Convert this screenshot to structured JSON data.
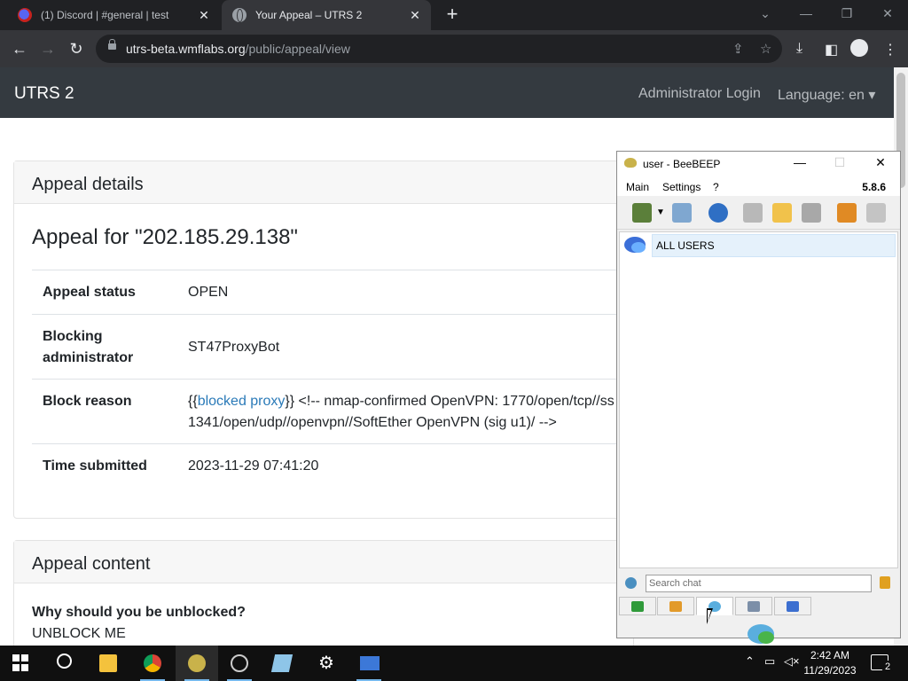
{
  "browser": {
    "tabs": [
      {
        "title": "(1) Discord | #general | test",
        "close": "✕"
      },
      {
        "title": "Your Appeal – UTRS 2",
        "close": "✕"
      }
    ],
    "new_tab": "+",
    "url_host": "utrs-beta.wmflabs.org",
    "url_path": "/public/appeal/view"
  },
  "page": {
    "brand": "UTRS 2",
    "nav": {
      "admin_login": "Administrator Login",
      "language": "Language: en ▾"
    },
    "details_card": {
      "header": "Appeal details",
      "title": "Appeal for \"202.185.29.138\"",
      "rows": {
        "status_label": "Appeal status",
        "status_value": "OPEN",
        "admin_label": "Blocking administrator",
        "admin_value": "ST47ProxyBot",
        "reason_label": "Block reason",
        "reason_prefix": "{{",
        "reason_link": "blocked proxy",
        "reason_line1_rest": "}} <!-- nmap-confirmed OpenVPN: 1770/open/tcp//ss",
        "reason_line2": "1341/open/udp//openvpn//SoftEther OpenVPN (sig u1)/ -->",
        "time_label": "Time submitted",
        "time_value": "2023-11-29 07:41:20"
      }
    },
    "content_card": {
      "header": "Appeal content",
      "question": "Why should you be unblocked?",
      "answer": "UNBLOCK ME"
    }
  },
  "beebeep": {
    "title": "user - BeeBEEP",
    "menu": [
      "Main",
      "Settings",
      "?"
    ],
    "version": "5.8.6",
    "chat_item": "ALL USERS",
    "search_placeholder": "Search chat"
  },
  "taskbar": {
    "time": "2:42 AM",
    "date": "11/29/2023",
    "notifications": "2"
  },
  "colors": {
    "navbar": "#343a40",
    "link": "#2a7ab8",
    "selection": "#e5f1fb"
  }
}
